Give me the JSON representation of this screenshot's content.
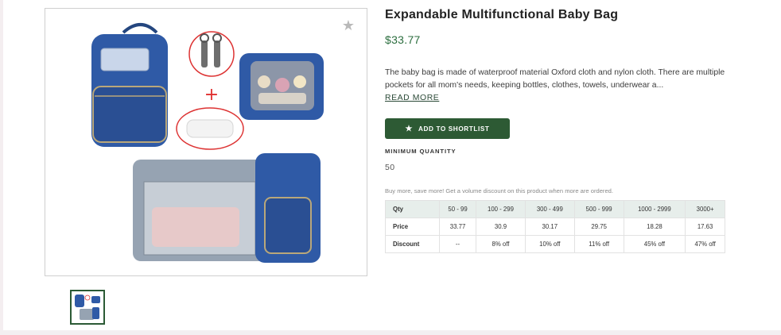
{
  "product": {
    "title": "Expandable Multifunctional Baby Bag",
    "price": "$33.77",
    "description": "The baby bag is made of waterproof material Oxford cloth and nylon cloth. There are multiple pockets for all mom's needs, keeping bottles, clothes, towels, underwear a...",
    "read_more": "READ MORE",
    "shortlist_button": "ADD TO SHORTLIST",
    "min_qty_label": "MINIMUM QUANTITY",
    "min_qty_value": "50",
    "promo_text": "Buy more, save more! Get a volume discount on this product when more are ordered."
  },
  "volume_table": {
    "headers": [
      "Qty",
      "50 - 99",
      "100 - 299",
      "300 - 499",
      "500 - 999",
      "1000 - 2999",
      "3000+"
    ],
    "price_row": [
      "Price",
      "33.77",
      "30.9",
      "30.17",
      "29.75",
      "18.28",
      "17.63"
    ],
    "discount_row": [
      "Discount",
      "--",
      "8% off",
      "10% off",
      "11% off",
      "45% off",
      "47% off"
    ]
  },
  "icons": {
    "favorite": "star-icon",
    "button": "star-icon"
  },
  "colors": {
    "accent": "#2d5a34",
    "price": "#2c6e3f",
    "table_header": "#e7eeeb",
    "bag_blue": "#2f5aa6"
  }
}
